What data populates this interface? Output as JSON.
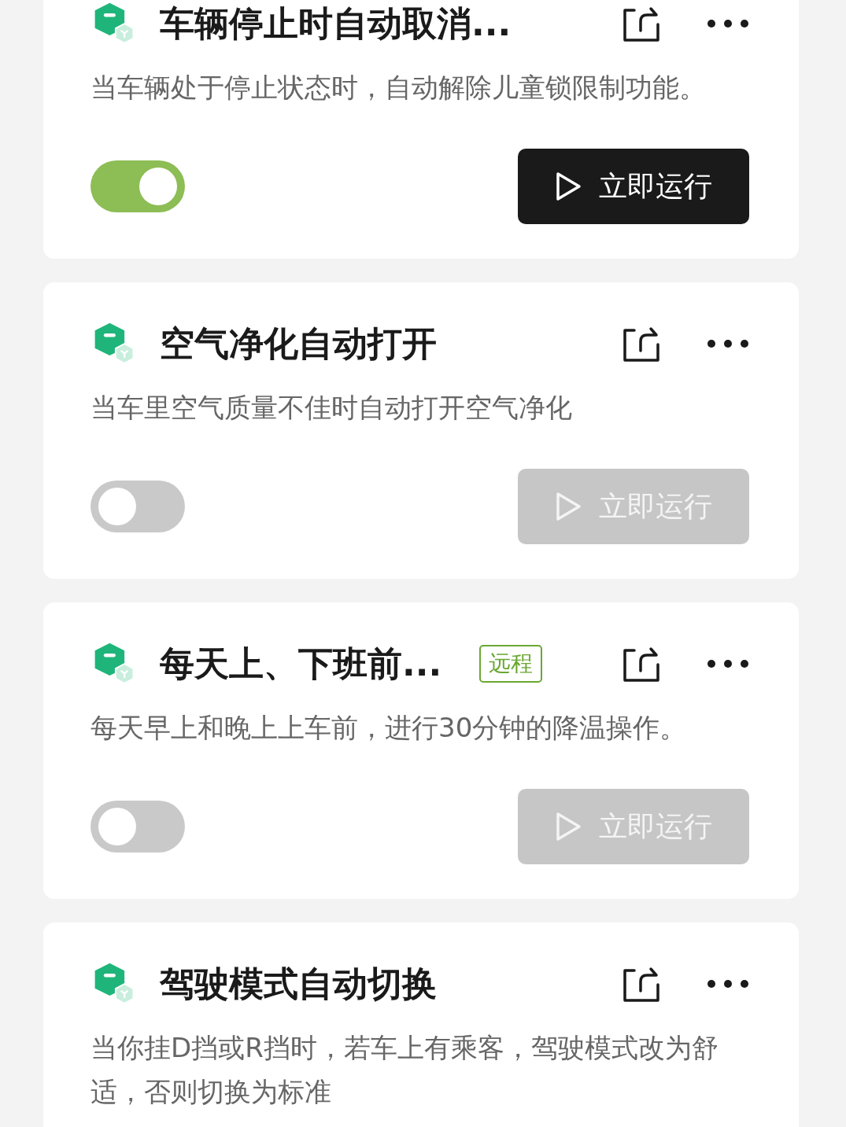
{
  "scenes": [
    {
      "title": "车辆停止时自动取消...",
      "description": "当车辆处于停止状态时，自动解除儿童锁限制功能。",
      "on": true,
      "run_button": {
        "label": "立即运行",
        "disabled": false
      }
    },
    {
      "title": "空气净化自动打开",
      "description": "当车里空气质量不佳时自动打开空气净化",
      "on": false,
      "run_button": {
        "label": "立即运行",
        "disabled": true
      }
    },
    {
      "title": "每天上、下班前...",
      "tag": "远程",
      "description": "每天早上和晚上上车前，进行30分钟的降温操作。",
      "on": false,
      "run_button": {
        "label": "立即运行",
        "disabled": true
      }
    },
    {
      "title": "驾驶模式自动切换",
      "description": "当你挂D挡或R挡时，若车上有乘客，驾驶模式改为舒适，否则切换为标准"
    }
  ]
}
